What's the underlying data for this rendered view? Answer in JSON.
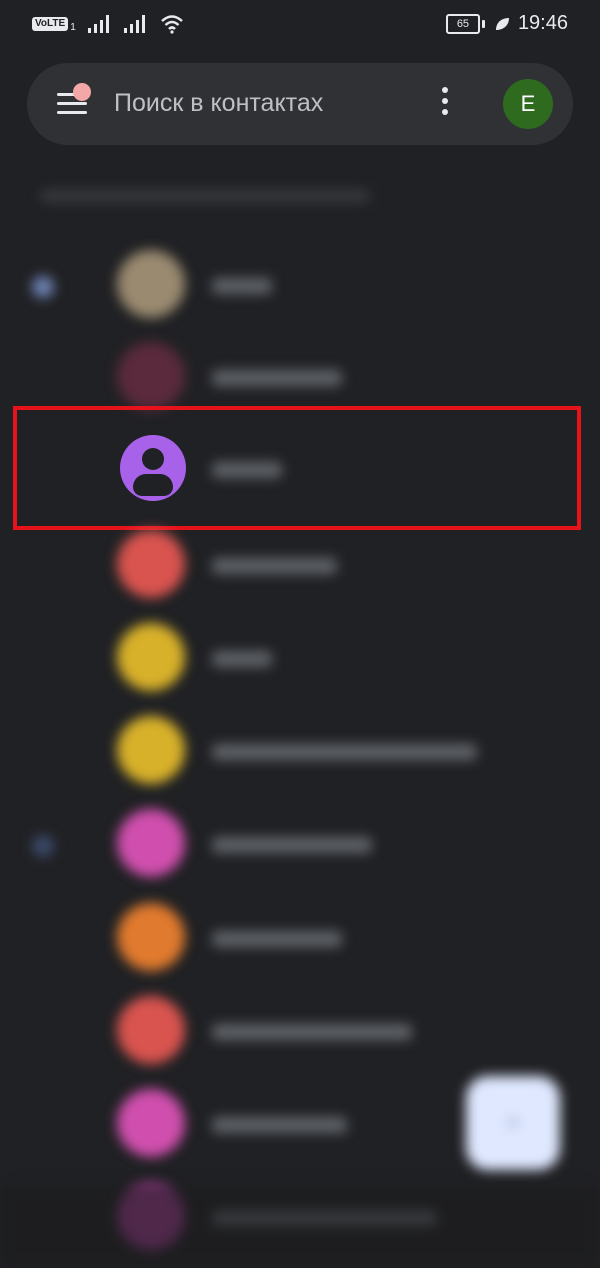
{
  "status_bar": {
    "volte": "VoLTE",
    "sim": "1",
    "battery": "65",
    "time": "19:46"
  },
  "search": {
    "placeholder": "Поиск в контактах",
    "account_initial": "E"
  },
  "colors": {
    "background": "#202124",
    "search_bg": "#303134",
    "account_avatar": "#2e6b1f",
    "highlight_avatar": "#a862ea",
    "highlight_border": "#e8121b",
    "fab": "#dfe8ff"
  },
  "contacts": [
    {
      "avatar_color": "#9a8a70",
      "letter_dot": "#6f83b6"
    },
    {
      "avatar_color": "#5b2a3c"
    },
    {
      "avatar_color": "#a862ea",
      "highlighted": true
    },
    {
      "avatar_color": "#d9544f"
    },
    {
      "avatar_color": "#d8b12a"
    },
    {
      "avatar_color": "#d8b12a"
    },
    {
      "avatar_color": "#d04fae",
      "letter_dot": "#3c4a6a"
    },
    {
      "avatar_color": "#e07a2e"
    },
    {
      "avatar_color": "#d9544f"
    },
    {
      "avatar_color": "#d04fae"
    },
    {
      "avatar_color": "#9c3b8e"
    }
  ]
}
